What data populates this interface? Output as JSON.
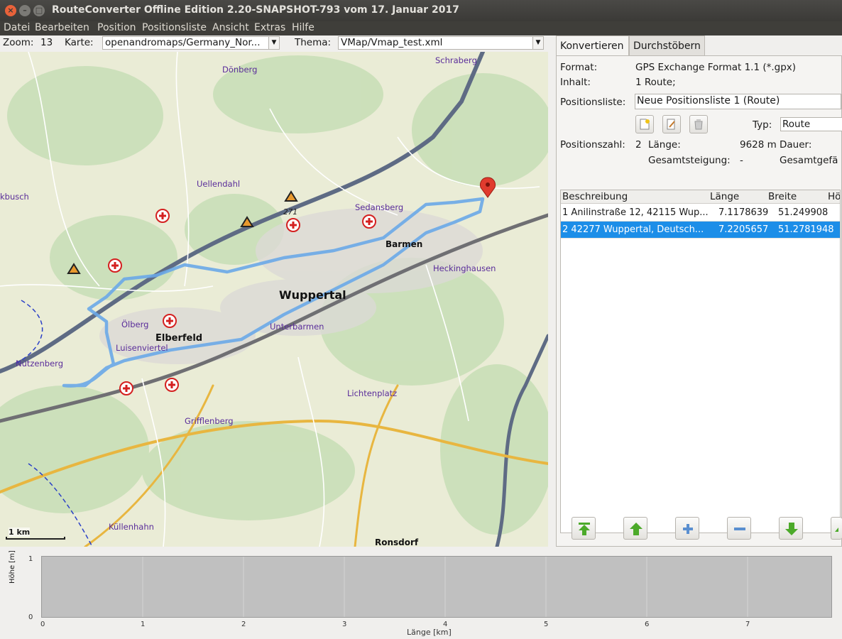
{
  "window": {
    "title": "RouteConverter Offline Edition 2.20-SNAPSHOT-793 vom 17. Januar 2017",
    "close_glyph": "×",
    "minimize_glyph": "–",
    "maximize_glyph": "□"
  },
  "menu": [
    "Datei",
    "Bearbeiten",
    "Position",
    "Positionsliste",
    "Ansicht",
    "Extras",
    "Hilfe"
  ],
  "toolbar": {
    "zoom_label": "Zoom:",
    "zoom_value": "13",
    "map_label": "Karte:",
    "map_value": "openandromaps/Germany_Nor...",
    "theme_label": "Thema:",
    "theme_value": "VMap/Vmap_test.xml"
  },
  "map": {
    "labels": [
      "Schraberg",
      "Dönberg",
      "Uellendahl",
      "kbusch",
      "Sedansberg",
      "Barmen",
      "Heckinghausen",
      "Wuppertal",
      "Unterbarmen",
      "Ölberg",
      "Elberfeld",
      "Luisenviertel",
      "Nützenberg",
      "Lichtenplatz",
      "Grifflenberg",
      "Küllenhahn",
      "Ronsdorf",
      "271"
    ],
    "scale_label": "1 km"
  },
  "panel": {
    "tabs": [
      "Konvertieren",
      "Durchstöbern"
    ],
    "format_label": "Format:",
    "format_value": "GPS Exchange Format 1.1 (*.gpx)",
    "content_label": "Inhalt:",
    "content_value": "1 Route;",
    "list_label": "Positionsliste:",
    "list_value": "Neue Positionsliste 1 (Route)",
    "type_label": "Typ:",
    "type_value": "Route",
    "count_label": "Positionszahl:",
    "count_value": "2",
    "length_label": "Länge:",
    "length_value": "9628 m",
    "duration_label": "Dauer:",
    "ascent_label": "Gesamtsteigung:",
    "ascent_value": "-",
    "descent_label": "Gesamtgefä",
    "columns": [
      "Beschreibung",
      "Länge",
      "Breite",
      "Hö"
    ],
    "rows": [
      {
        "desc": "1 Anilinstraße 12, 42115 Wup...",
        "lon": "7.1178639",
        "lat": "51.249908",
        "selected": false
      },
      {
        "desc": "2 42277 Wuppertal, Deutsch...",
        "lon": "7.2205657",
        "lat": "51.2781948",
        "selected": true
      }
    ]
  },
  "profile": {
    "ylabel": "Höhe [m]",
    "xlabel": "Länge [km]",
    "y_ticks": [
      "1",
      "0"
    ],
    "x_ticks": [
      "0",
      "1",
      "2",
      "3",
      "4",
      "5",
      "6",
      "7"
    ]
  },
  "colors": {
    "route": "#6aa8e8",
    "selection": "#1c8ee8",
    "title_bar": "#3b3a37",
    "close_button": "#e9623a",
    "profile_bg": "#c0c0c0"
  }
}
